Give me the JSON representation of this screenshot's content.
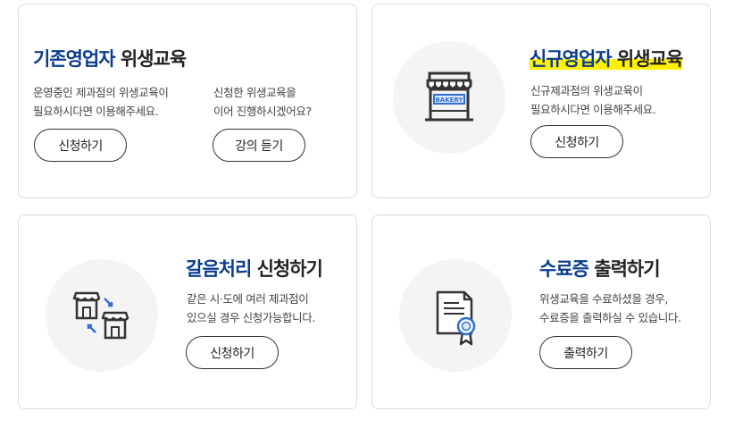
{
  "cards": {
    "existing": {
      "title_highlight": "기존영업자",
      "title_rest": " 위생교육",
      "left_desc": [
        "운영중인 제과점의 위생교육이",
        "필요하시다면 이용해주세요."
      ],
      "left_button": "신청하기",
      "right_desc": [
        "신청한 위생교육을",
        "이어 진행하시겠어요?"
      ],
      "right_button": "강의 듣기"
    },
    "new": {
      "title_highlight": "신규영업자",
      "title_rest": " 위생교육",
      "desc": [
        "신규제과점의 위생교육이",
        "필요하시다면 이용해주세요."
      ],
      "button": "신청하기",
      "icon": "bakery-store-icon",
      "icon_text": "BAKERY"
    },
    "replace": {
      "title_highlight": "갈음처리",
      "title_rest": " 신청하기",
      "desc": [
        "같은 시·도에 여러 제과점이",
        "있으실 경우 신청가능합니다."
      ],
      "button": "신청하기",
      "icon": "store-transfer-icon"
    },
    "certificate": {
      "title_highlight": "수료증",
      "title_rest": " 출력하기",
      "desc": [
        "위생교육을 수료하셨을 경우,",
        "수료증을 출력하실 수 있습니다."
      ],
      "button": "출력하기",
      "icon": "certificate-icon"
    }
  },
  "colors": {
    "title_accent": "#0a3d8f",
    "highlight": "#fff200",
    "icon_blue": "#2f6fd1",
    "border": "#dadada"
  }
}
